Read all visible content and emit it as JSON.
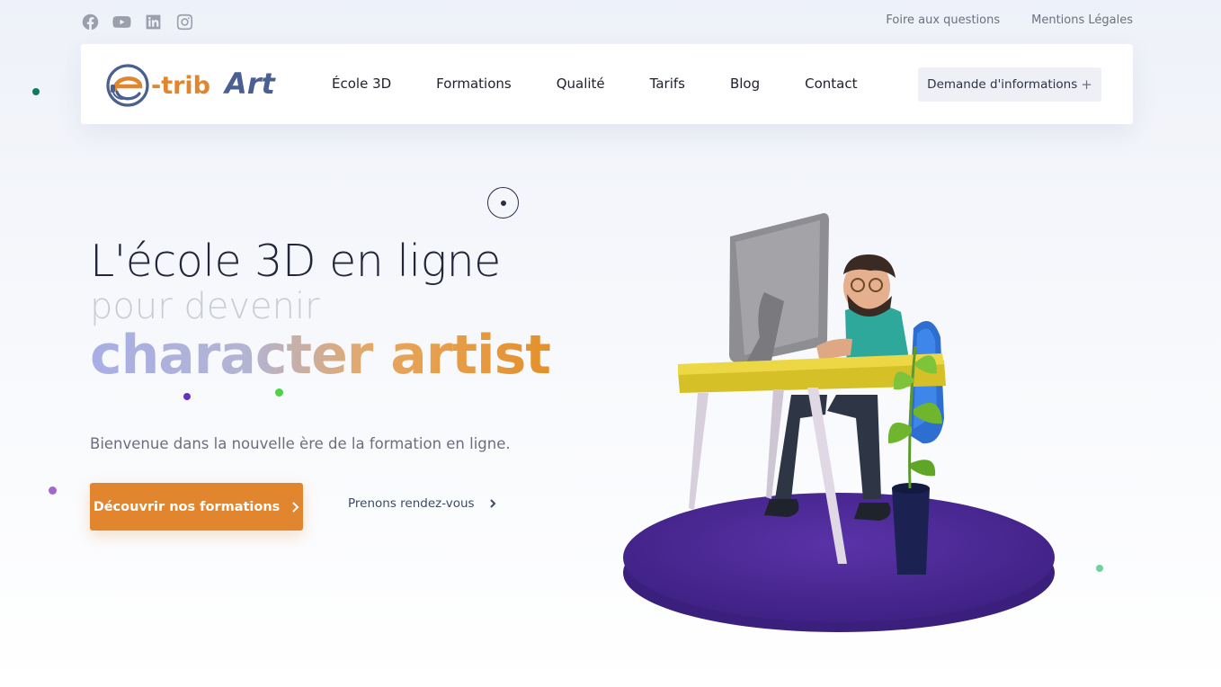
{
  "top_links": {
    "faq": "Foire aux questions",
    "legal": "Mentions Légales"
  },
  "socials": [
    "facebook-icon",
    "youtube-icon",
    "linkedin-icon",
    "instagram-icon"
  ],
  "logo": {
    "text_prefix": "e-trib",
    "text_suffix": "Art"
  },
  "nav": {
    "items": [
      {
        "label": "École 3D"
      },
      {
        "label": "Formations"
      },
      {
        "label": "Qualité"
      },
      {
        "label": "Tarifs"
      },
      {
        "label": "Blog"
      },
      {
        "label": "Contact"
      }
    ],
    "info_button": "Demande d'informations",
    "info_button_icon": "+"
  },
  "hero": {
    "line1": "L'école 3D en ligne",
    "line2": "pour devenir",
    "line3": "character artist",
    "subtitle": "Bienvenue dans la nouvelle ère de la formation en ligne.",
    "cta_label": "Découvrir nos formations",
    "secondary_link": "Prenons rendez-vous"
  },
  "colors": {
    "accent_orange": "#e1862e",
    "logo_blue": "#4a5f92",
    "logo_orange": "#e0862e",
    "platform_purple": "#4b2a94",
    "desk_yellow": "#e8d33a"
  }
}
